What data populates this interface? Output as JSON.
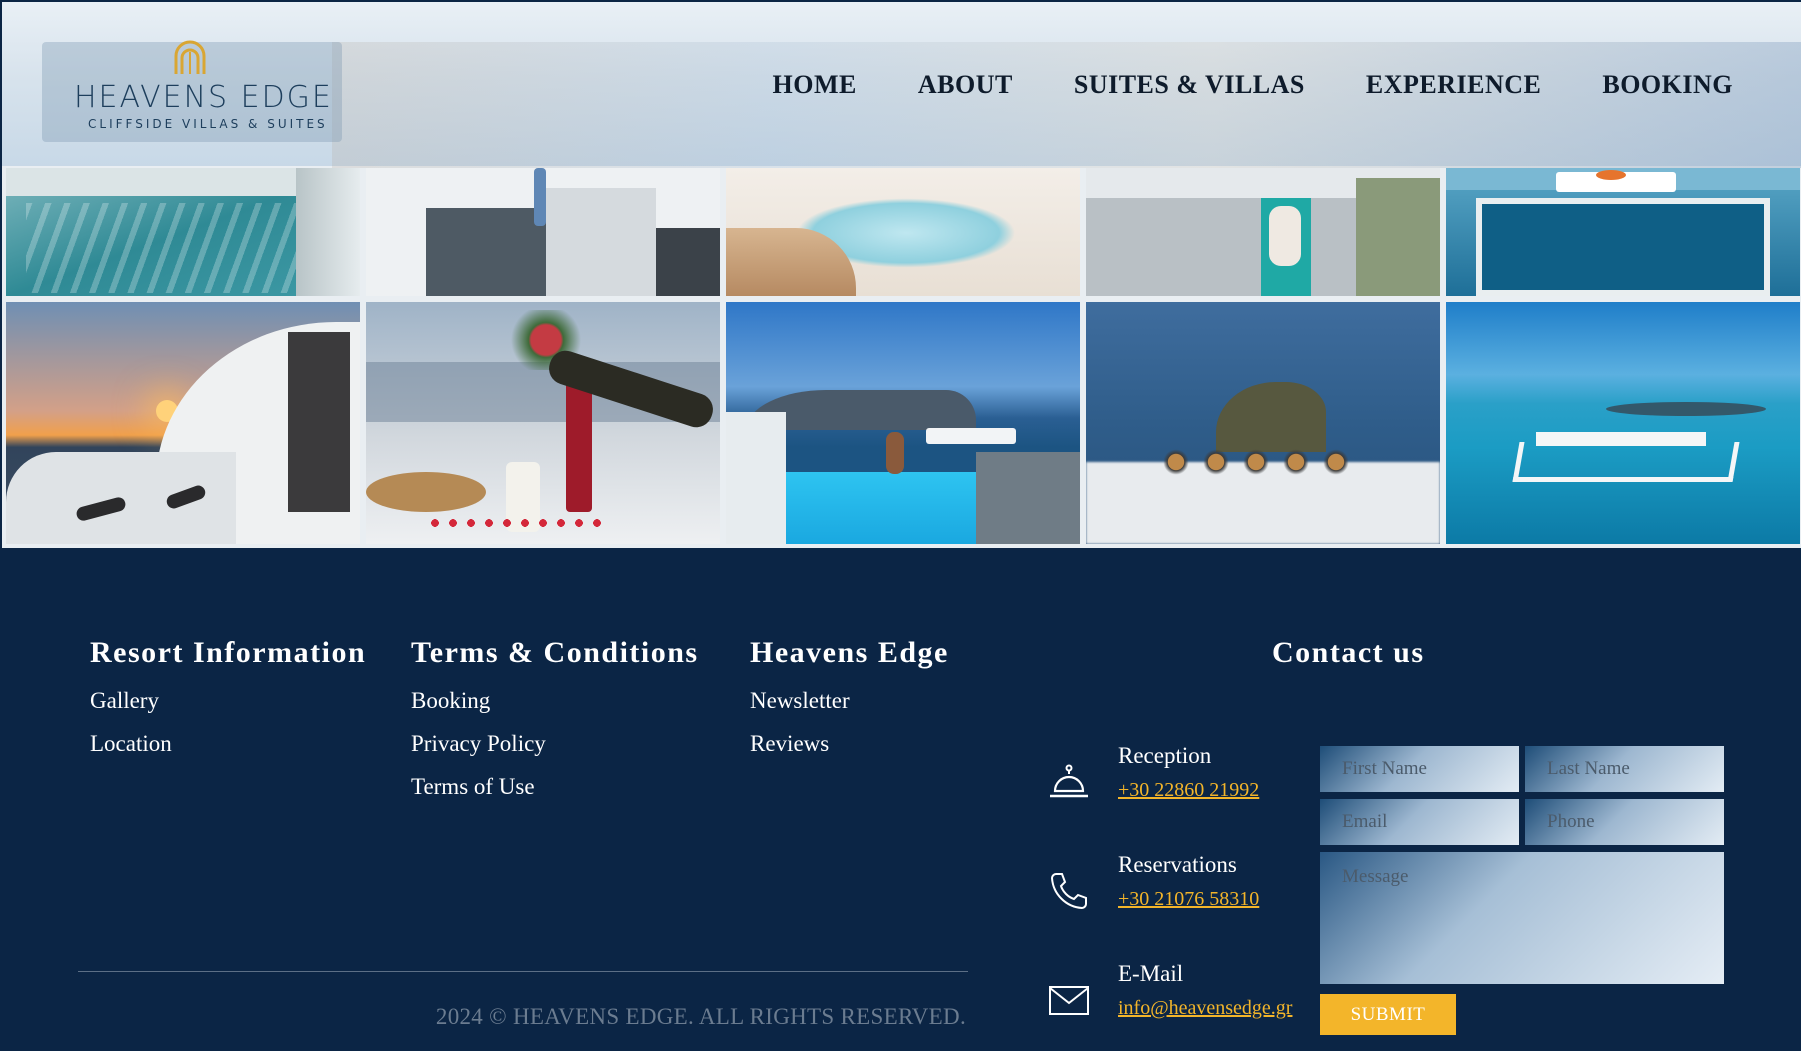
{
  "brand": {
    "name": "HEAVENS EDGE",
    "tagline": "CLIFFSIDE VILLAS & SUITES",
    "logo_color": "#d9a633"
  },
  "nav": {
    "items": [
      "HOME",
      "ABOUT",
      "SUITES & VILLAS",
      "EXPERIENCE",
      "BOOKING"
    ]
  },
  "gallery": {
    "rows": 2,
    "columns": 5,
    "images": [
      "plunge-pool-water",
      "cliffside-terrace-woman",
      "pool-wooden-deck",
      "sunbather-terrace",
      "pool-breakfast-tray",
      "sunset-terrace-cushions",
      "champagne-dinner-table",
      "infinity-pool-woman-cruise-ship",
      "breakfast-skaros-rock",
      "aerial-infinity-pool-caldera"
    ]
  },
  "footer": {
    "columns": [
      {
        "title": "Resort Information",
        "links": [
          "Gallery",
          "Location"
        ]
      },
      {
        "title": "Terms & Conditions",
        "links": [
          "Booking",
          "Privacy Policy",
          "Terms of Use"
        ]
      },
      {
        "title": "Heavens Edge",
        "links": [
          "Newsletter",
          "Reviews"
        ]
      }
    ],
    "contact": {
      "title": "Contact us",
      "items": [
        {
          "label": "Reception",
          "value": "+30 22860 21992",
          "icon": "bell-icon"
        },
        {
          "label": "Reservations",
          "value": "+30 21076 58310",
          "icon": "phone-icon"
        },
        {
          "label": "E-Mail",
          "value": "info@heavensedge.gr",
          "icon": "envelope-icon"
        }
      ],
      "form": {
        "first_name_placeholder": "First Name",
        "last_name_placeholder": "Last Name",
        "email_placeholder": "Email",
        "phone_placeholder": "Phone",
        "message_placeholder": "Message",
        "submit_label": "SUBMIT"
      }
    },
    "copyright": "2024 © HEAVENS EDGE. ALL RIGHTS RESERVED."
  },
  "colors": {
    "footer_bg": "#0b2545",
    "accent": "#f3b52a",
    "nav_text": "#0e1b2b"
  }
}
